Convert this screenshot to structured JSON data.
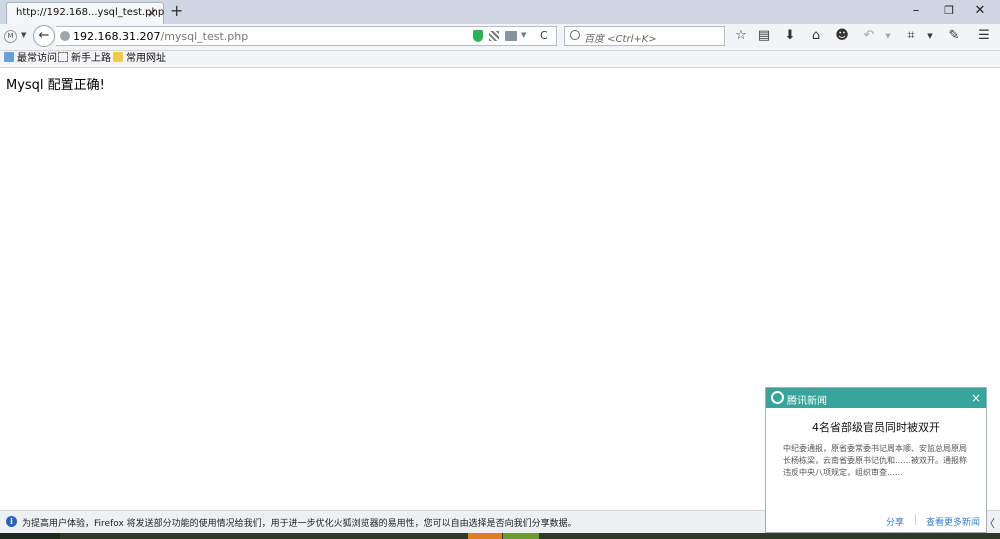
{
  "browser": {
    "tab_title": "http://192.168...ysql_test.php",
    "tab_close": "×",
    "new_tab": "+",
    "window_controls": {
      "minimize": "–",
      "maximize": "❐",
      "close": "✕"
    },
    "url_host": "192.168.31.207",
    "url_path": "/mysql_test.php",
    "search_placeholder": "百度 <Ctrl+K>",
    "identity_label": "M",
    "back_glyph": "←",
    "reload_glyph": "C",
    "toolbar_icons": [
      "bookmark-star-icon",
      "reading-list-icon",
      "download-icon",
      "home-icon",
      "chat-icon",
      "undo-icon",
      "crop-icon",
      "comment-icon",
      "menu-icon"
    ]
  },
  "bookmarks": [
    {
      "label": "最常访问",
      "icon": "bookmark-folder-icon"
    },
    {
      "label": "新手上路",
      "icon": "page-icon"
    },
    {
      "label": "常用网址",
      "icon": "folder-icon"
    }
  ],
  "page": {
    "message": "Mysql 配置正确!"
  },
  "notification": {
    "info_glyph": "i",
    "text": "为提高用户体验，Firefox 将发送部分功能的使用情况给我们，用于进一步优化火狐浏览器的易用性，您可以自由选择是否向我们分享数据。",
    "arrow": "〈"
  },
  "news_popup": {
    "source": "腾讯新闻",
    "close": "×",
    "headline": "4名省部级官员同时被双开",
    "body": "中纪委通报，原省委常委书记周本顺、安监总局原局长杨栋梁，云南省委原书记仇和……被双开。通报称违反中央八项规定，组织审查……",
    "share": "分享",
    "more": "查看更多新闻",
    "accent": "#37a59b"
  }
}
